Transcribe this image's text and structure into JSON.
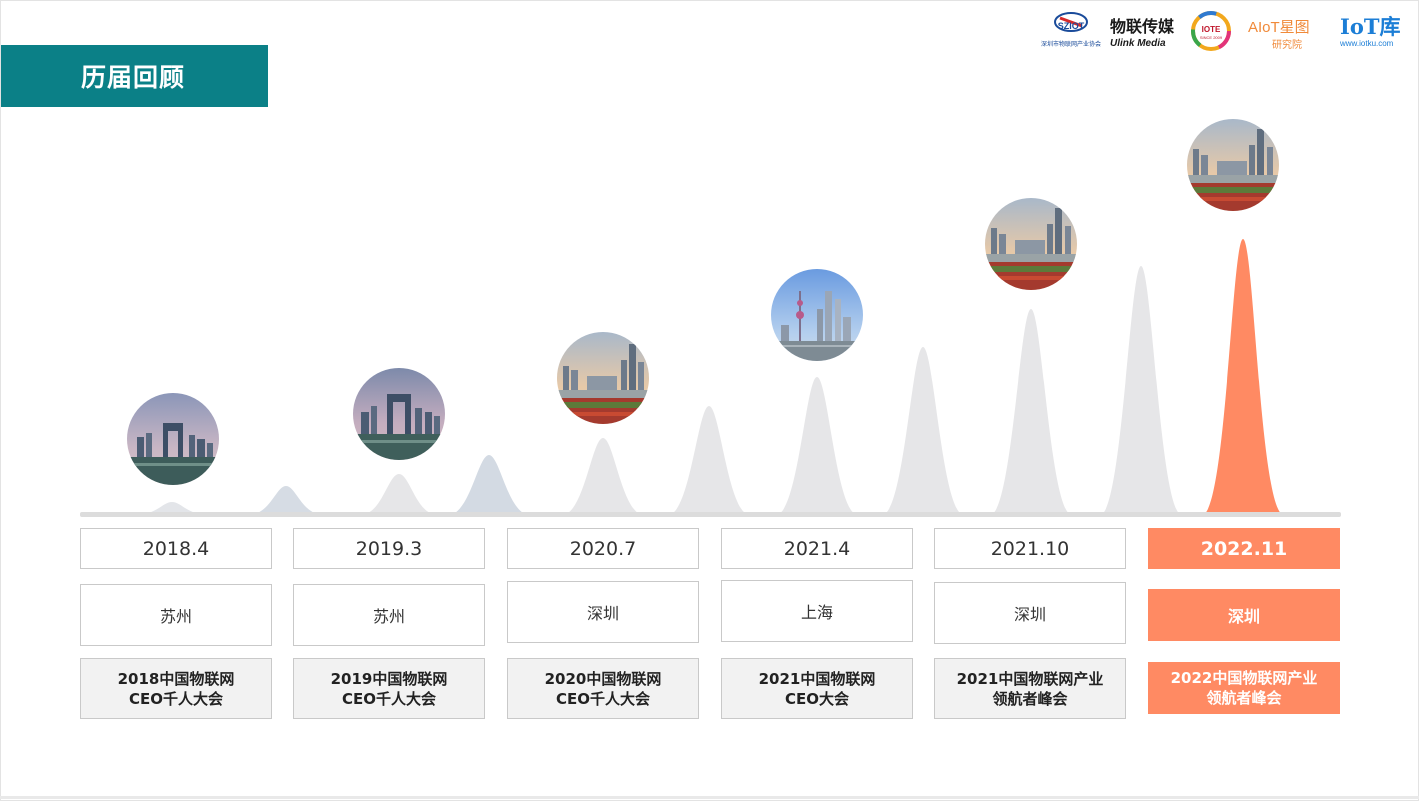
{
  "header": {
    "title": "历届回顾"
  },
  "logos": [
    {
      "name": "sziot-logo",
      "text": "SZIOT",
      "subtext": "深圳市物联网产业协会"
    },
    {
      "name": "ulink-media-logo",
      "text": "物联传媒",
      "subtext": "Ulink Media"
    },
    {
      "name": "iote-logo",
      "text": "IOTE",
      "subtext": "SINCE 2009"
    },
    {
      "name": "aiot-star-logo",
      "text": "AIoT星图",
      "subtext": "研究院"
    },
    {
      "name": "iotku-logo",
      "text": "IoT库",
      "subtext": "www.iotku.com"
    }
  ],
  "timeline": [
    {
      "date": "2018.4",
      "city": "苏州",
      "event": "2018中国物联网\nCEO千人大会",
      "image": "suzhou-gate",
      "highlight": false
    },
    {
      "date": "2019.3",
      "city": "苏州",
      "event": "2019中国物联网\nCEO千人大会",
      "image": "suzhou-gate",
      "highlight": false
    },
    {
      "date": "2020.7",
      "city": "深圳",
      "event": "2020中国物联网\nCEO千人大会",
      "image": "shenzhen-skyline",
      "highlight": false
    },
    {
      "date": "2021.4",
      "city": "上海",
      "event": "2021中国物联网\nCEO大会",
      "image": "shanghai-skyline",
      "highlight": false
    },
    {
      "date": "2021.10",
      "city": "深圳",
      "event": "2021中国物联网产业\n领航者峰会",
      "image": "shenzhen-skyline",
      "highlight": false
    },
    {
      "date": "2022.11",
      "city": "深圳",
      "event": "2022中国物联网产业\n领航者峰会",
      "image": "shenzhen-skyline",
      "highlight": true
    }
  ],
  "colors": {
    "title_bg": "#0b8087",
    "highlight": "#ff8a63",
    "peak_grey": "#e6e6e8",
    "peak_blue": "#d3dae3"
  }
}
